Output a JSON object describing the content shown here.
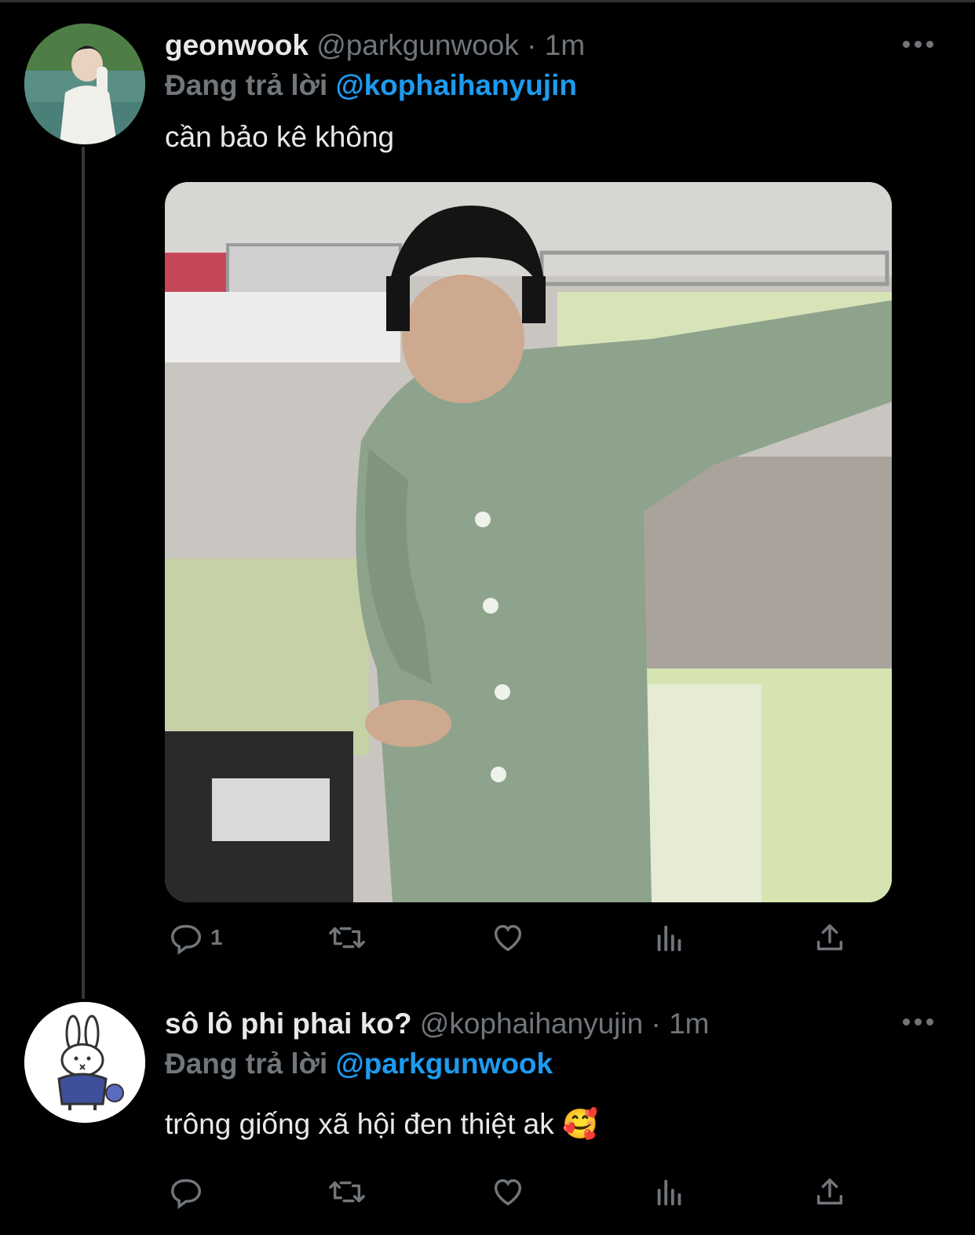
{
  "tweets": [
    {
      "display_name": "geonwook",
      "handle": "@parkgunwook",
      "time": "· 1m",
      "replying_label": "Đang trả lời",
      "replying_to": "@kophaihanyujin",
      "text": "cần bảo kê không",
      "reply_count": "1",
      "icons": [
        "reply-icon",
        "retweet-icon",
        "like-icon",
        "views-icon",
        "share-icon"
      ]
    },
    {
      "display_name": "sô lô phi phai ko?",
      "handle": "@kophaihanyujin",
      "time": "· 1m",
      "replying_label": "Đang trả lời",
      "replying_to": "@parkgunwook",
      "text": "trông giống xã hội đen thiệt ak 🥰",
      "reply_count": "",
      "icons": [
        "reply-icon",
        "retweet-icon",
        "like-icon",
        "views-icon",
        "share-icon"
      ]
    }
  ],
  "colors": {
    "background": "#000000",
    "text": "#e7e9ea",
    "muted": "#71767b",
    "accent": "#1d9bf0"
  }
}
